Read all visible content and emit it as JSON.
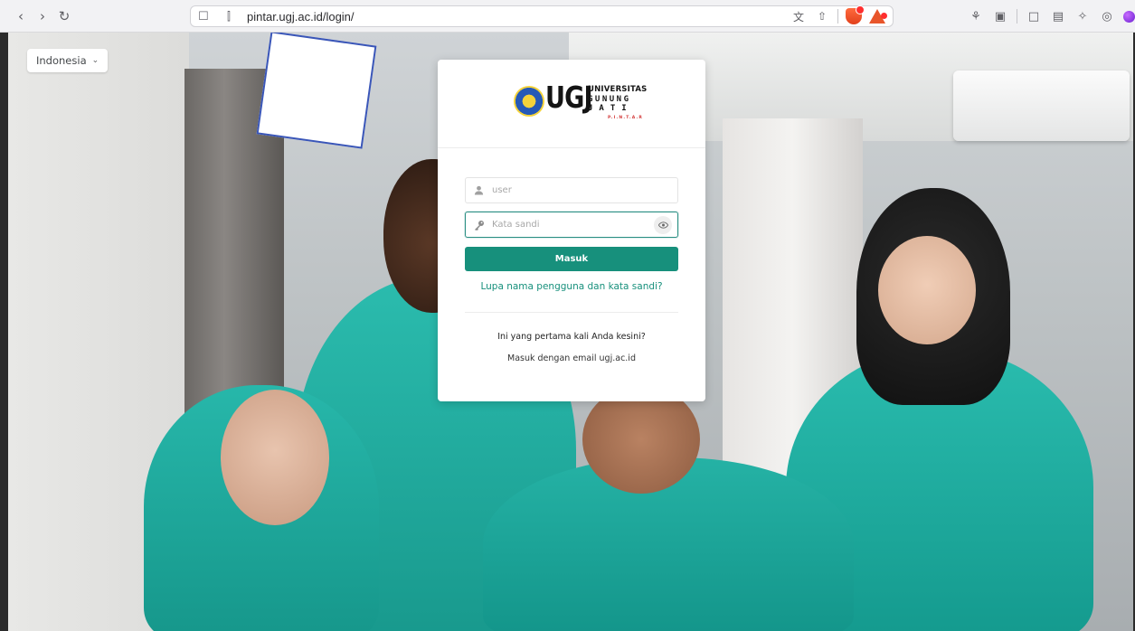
{
  "browser": {
    "url": "pintar.ugj.ac.id/login/",
    "icons": [
      "back-icon",
      "forward-icon",
      "reload-icon",
      "bookmark-icon",
      "site-settings-icon",
      "translate-icon",
      "share-icon",
      "brave-shields-icon",
      "brave-rewards-icon",
      "extensions-icon",
      "sidebar-icon",
      "wallet-icon",
      "vpn-icon",
      "menu-icon"
    ]
  },
  "page": {
    "language": {
      "selected": "Indonesia"
    },
    "logo": {
      "abbr": "UGJ",
      "university": "UNIVERSITAS",
      "gunung": "GUNUNG",
      "jati": "JATI",
      "pintar": "P.I.N.T.A.R"
    },
    "form": {
      "username_placeholder": "user",
      "password_placeholder": "Kata sandi",
      "submit_label": "Masuk",
      "forgot_link": "Lupa nama pengguna dan kata sandi?",
      "first_time_text": "Ini yang pertama kali Anda kesini?",
      "email_login_link": "Masuk dengan email ugj.ac.id"
    },
    "colors": {
      "accent": "#17907c"
    }
  }
}
